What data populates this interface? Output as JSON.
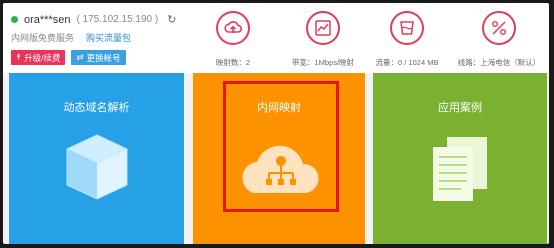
{
  "user": {
    "name": "ora***sen",
    "ip": "( 175.102.15.190 )"
  },
  "links": {
    "plan": "内网版免费服务",
    "buy": "购买流量包"
  },
  "buttons": {
    "upgrade": "升级/续费",
    "switch": "更换帐号"
  },
  "stats": [
    {
      "icon": "cloud-upload-icon",
      "label": "映射数：2"
    },
    {
      "icon": "bandwidth-chart-icon",
      "label": "带宽：1Mbps/映射"
    },
    {
      "icon": "traffic-cup-icon",
      "label": "流量：0 / 1024 MB"
    },
    {
      "icon": "route-icon",
      "label": "线路：上海电信（默认）"
    }
  ],
  "cards": [
    {
      "title": "动态域名解析",
      "icon": "cube-icon"
    },
    {
      "title": "内网映射",
      "icon": "cloud-network-icon"
    },
    {
      "title": "应用案例",
      "icon": "documents-icon"
    }
  ],
  "colors": {
    "accent_red": "#e53b56",
    "card_blue": "#27a1e6",
    "card_orange": "#fd9200",
    "card_green": "#7bb131",
    "highlight_box": "#e8141c"
  }
}
